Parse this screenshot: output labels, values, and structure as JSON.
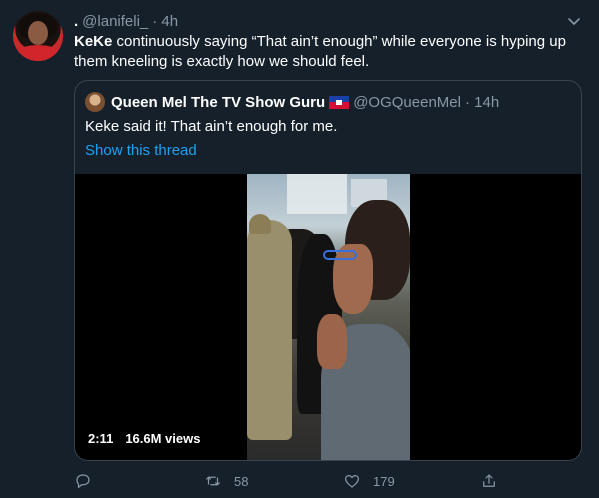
{
  "tweet": {
    "dot": ".",
    "handle": "@lanifeli_",
    "time": "· 4h",
    "text_name": "KeKe",
    "text_rest": " continuously saying “That ain’t enough” while everyone is hyping up them kneeling is exactly how we should feel."
  },
  "quote": {
    "name": "Queen Mel The TV Show Guru",
    "handle": "@OGQueenMel",
    "time": "· 14h",
    "text": "Keke said it! That ain’t enough for me.",
    "link": "Show this thread",
    "video": {
      "duration": "2:11",
      "views": "16.6M views"
    }
  },
  "actions": {
    "reply": "",
    "retweet": "58",
    "like": "179"
  },
  "icons": [
    "chevron-down-icon",
    "reply-icon",
    "retweet-icon",
    "like-icon",
    "share-icon"
  ],
  "colors": {
    "background": "#15202b",
    "border": "#38444d",
    "muted": "#8899a6",
    "link": "#1da1f2",
    "flag_blue": "#1b3fa8",
    "flag_red": "#d21034"
  }
}
